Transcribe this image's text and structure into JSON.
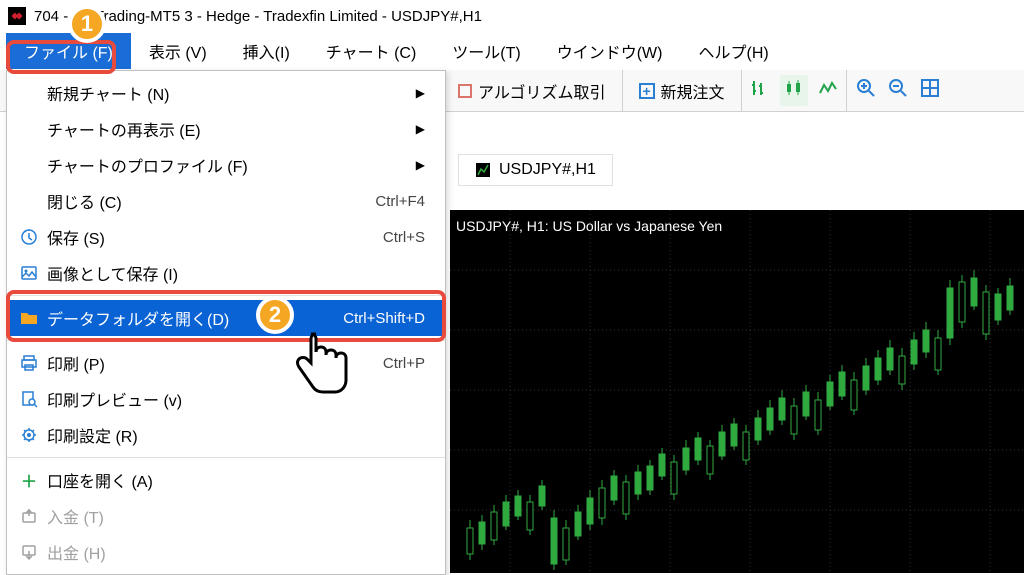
{
  "title": "704          - XMTrading-MT5 3 - Hedge - Tradexfin Limited - USDJPY#,H1",
  "menu": {
    "file": "ファイル (F)",
    "view": "表示 (V)",
    "insert": "挿入(I)",
    "chart": "チャート (C)",
    "tools": "ツール(T)",
    "window": "ウインドウ(W)",
    "help": "ヘルプ(H)"
  },
  "toolbar": {
    "algo": "アルゴリズム取引",
    "neworder": "新規注文"
  },
  "dropdown": {
    "newchart": "新規チャート (N)",
    "reshow": "チャートの再表示 (E)",
    "profile": "チャートのプロファイル (F)",
    "close": "閉じる (C)",
    "close_sc": "Ctrl+F4",
    "save": "保存 (S)",
    "save_sc": "Ctrl+S",
    "saveimg": "画像として保存 (I)",
    "datafolder": "データフォルダを開く(D)",
    "datafolder_sc": "Ctrl+Shift+D",
    "print": "印刷 (P)",
    "print_sc": "Ctrl+P",
    "preview": "印刷プレビュー (v)",
    "printset": "印刷設定 (R)",
    "openacct": "口座を開く (A)",
    "deposit": "入金 (T)",
    "withdraw": "出金 (H)"
  },
  "callouts": {
    "one": "1",
    "two": "2"
  },
  "symbol_tab": "USDJPY#,H1",
  "chart_label": "USDJPY#, H1:  US Dollar vs Japanese Yen",
  "chart_data": {
    "type": "candlestick",
    "symbol": "USDJPY#",
    "timeframe": "H1",
    "description": "US Dollar vs Japanese Yen"
  }
}
